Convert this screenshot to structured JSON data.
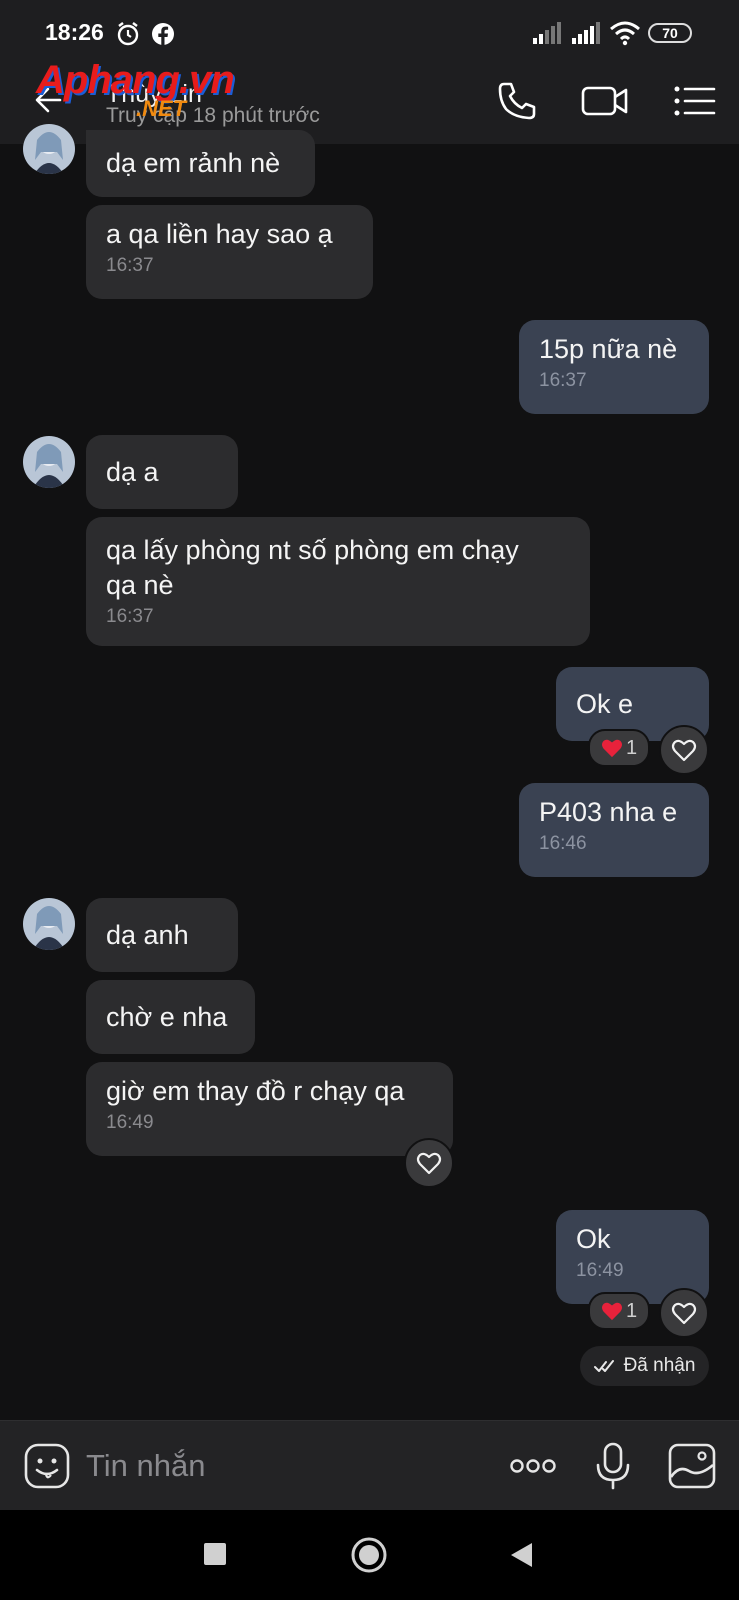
{
  "status_bar": {
    "time": "18:26",
    "battery": "70"
  },
  "header": {
    "contact_name": "Thùy Lin",
    "last_seen": "Truy cập 18 phút trước",
    "watermark_main": "Aphang.vn",
    "watermark_sub": ".NET"
  },
  "messages": [
    {
      "id": 1,
      "dir": "in",
      "text": "dạ em rảnh nè",
      "time": ""
    },
    {
      "id": 2,
      "dir": "in",
      "text": "a qa liền hay sao ạ",
      "time": "16:37"
    },
    {
      "id": 3,
      "dir": "out",
      "text": "15p nữa nè",
      "time": "16:37"
    },
    {
      "id": 4,
      "dir": "in",
      "text": "dạ a",
      "time": ""
    },
    {
      "id": 5,
      "dir": "in",
      "text": "qa lấy phòng nt số phòng em chạy\nqa nè",
      "time": "16:37"
    },
    {
      "id": 6,
      "dir": "out",
      "text": "Ok e",
      "time": "",
      "reaction_count": "1"
    },
    {
      "id": 7,
      "dir": "out",
      "text": "P403 nha e",
      "time": "16:46"
    },
    {
      "id": 8,
      "dir": "in",
      "text": "dạ anh",
      "time": ""
    },
    {
      "id": 9,
      "dir": "in",
      "text": "chờ e nha",
      "time": ""
    },
    {
      "id": 10,
      "dir": "in",
      "text": "giờ em thay đồ r chạy qa",
      "time": "16:49"
    },
    {
      "id": 11,
      "dir": "out",
      "text": "Ok",
      "time": "16:49",
      "reaction_count": "1"
    }
  ],
  "delivery_status": "Đã nhận",
  "composer": {
    "placeholder": "Tin nhắn"
  },
  "icons": [
    "alarm-icon",
    "facebook-icon",
    "signal-icon",
    "wifi-icon",
    "battery-icon",
    "back-arrow-icon",
    "phone-icon",
    "video-call-icon",
    "menu-list-icon",
    "heart-icon",
    "red-heart-icon",
    "double-check-icon",
    "emoji-icon",
    "more-icon",
    "microphone-icon",
    "image-icon",
    "nav-recents-icon",
    "nav-home-icon",
    "nav-back-icon"
  ],
  "colors": {
    "background": "#111112",
    "incoming_bubble": "#2c2c2e",
    "outgoing_bubble": "#3a4252",
    "reaction_heart": "#e8223b"
  }
}
